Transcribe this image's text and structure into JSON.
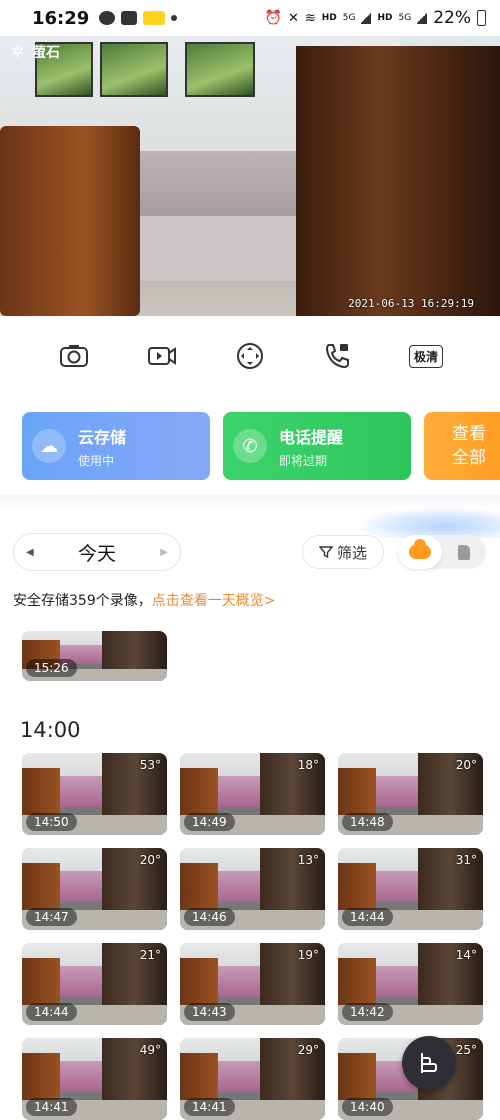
{
  "status_bar": {
    "time": "16:29",
    "battery": "22%",
    "network_labels": [
      "HD",
      "5G",
      "HD",
      "5G"
    ]
  },
  "video": {
    "brand": "萤石",
    "timestamp": "2021-06-13 16:29:19"
  },
  "toolbar": {
    "items": [
      "camera-icon",
      "record-video-icon",
      "fullscreen-focus-icon",
      "video-call-icon"
    ],
    "quality_label": "极清"
  },
  "cards": [
    {
      "title": "云存储",
      "subtitle": "使用中",
      "icon": "cloud-upload-icon",
      "color": "#6aa3f8"
    },
    {
      "title": "电话提醒",
      "subtitle": "即将过期",
      "icon": "phone-icon",
      "color": "#3dd36b"
    },
    {
      "line1": "查看",
      "line2": "全部",
      "color": "#ff9a1f"
    }
  ],
  "date_selector": {
    "label": "今天"
  },
  "filter": {
    "label": "筛选"
  },
  "storage_toggle": {
    "options": [
      "cloud",
      "sd-card"
    ],
    "selected": "cloud"
  },
  "summary": {
    "text": "安全存储359个录像，",
    "link": "点击查看一天概览>"
  },
  "recordings": {
    "top_item": {
      "time": "15:26"
    },
    "hour_label": "14:00",
    "items": [
      {
        "time": "14:50",
        "angle": "53°"
      },
      {
        "time": "14:49",
        "angle": "18°"
      },
      {
        "time": "14:48",
        "angle": "20°"
      },
      {
        "time": "14:47",
        "angle": "20°"
      },
      {
        "time": "14:46",
        "angle": "13°"
      },
      {
        "time": "14:44",
        "angle": "31°"
      },
      {
        "time": "14:44",
        "angle": "21°"
      },
      {
        "time": "14:43",
        "angle": "19°"
      },
      {
        "time": "14:42",
        "angle": "14°"
      },
      {
        "time": "14:41",
        "angle": "49°"
      },
      {
        "time": "14:41",
        "angle": "29°"
      },
      {
        "time": "14:40",
        "angle": "25°"
      }
    ]
  }
}
